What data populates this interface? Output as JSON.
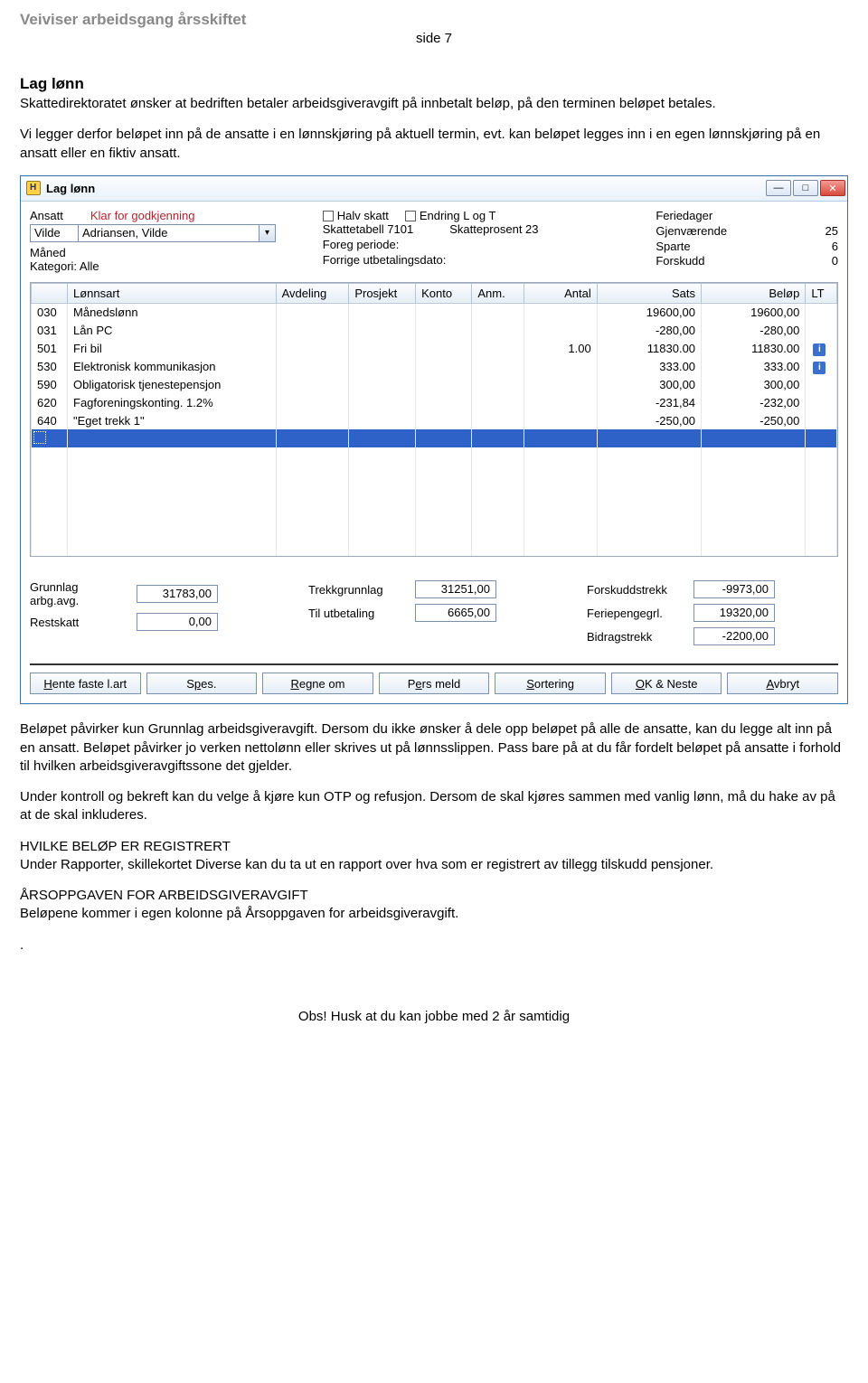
{
  "doc": {
    "header": "Veiviser arbeidsgang årsskiftet",
    "page": "side 7",
    "section_title": "Lag lønn",
    "para1": "Skattedirektoratet ønsker at bedriften betaler arbeidsgiveravgift på innbetalt beløp, på den terminen beløpet betales.",
    "para2": "Vi legger derfor beløpet inn på de ansatte i en lønnskjøring på aktuell termin, evt. kan beløpet legges inn i en egen lønnskjøring på en ansatt eller en fiktiv ansatt.",
    "para3": "Beløpet påvirker kun Grunnlag arbeidsgiveravgift. Dersom du ikke ønsker å dele opp beløpet på alle de ansatte, kan du legge alt inn på en ansatt. Beløpet påvirker jo verken nettolønn eller skrives ut på lønnsslippen. Pass bare på at du får fordelt beløpet på ansatte i forhold til hvilken arbeidsgiveravgiftssone det gjelder.",
    "para4": "Under kontroll og bekreft kan du velge å kjøre kun OTP og refusjon. Dersom de skal kjøres sammen med vanlig lønn, må du hake av på at de skal inkluderes.",
    "para5_title": "HVILKE BELØP ER REGISTRERT",
    "para5": "Under Rapporter, skillekortet Diverse kan du ta ut en rapport over hva som er registrert av tillegg tilskudd pensjoner.",
    "para6_title": "ÅRSOPPGAVEN FOR ARBEIDSGIVERAVGIFT",
    "para6": "Beløpene kommer i egen kolonne på Årsoppgaven for arbeidsgiveravgift.",
    "footer": "Obs! Husk at du kan jobbe med 2 år samtidig"
  },
  "app": {
    "title": "Lag lønn",
    "info": {
      "ansatt_label": "Ansatt",
      "status_label": "Klar for godkjenning",
      "ansatt_name_first": "Vilde",
      "ansatt_name_full": "Adriansen, Vilde",
      "maned_label": "Måned",
      "kategori_label": "Kategori: Alle",
      "halv_skatt": "Halv skatt",
      "endring": "Endring L og T",
      "skattetabell": "Skattetabell 7101",
      "skatteprosent": "Skatteprosent 23",
      "foreg": "Foreg periode:",
      "forrige_utb": "Forrige utbetalingsdato:",
      "feriedager_label": "Feriedager",
      "gjen_label": "Gjenværende",
      "gjen_val": "25",
      "sparte_label": "Sparte",
      "sparte_val": "6",
      "forskudd_label": "Forskudd",
      "forskudd_val": "0"
    },
    "table": {
      "headers": [
        "",
        "Lønnsart",
        "Avdeling",
        "Prosjekt",
        "Konto",
        "Anm.",
        "Antal",
        "Sats",
        "Beløp",
        "LT"
      ],
      "rows": [
        {
          "code": "030",
          "name": "Månedslønn",
          "antal": "",
          "sats": "19600,00",
          "belop": "19600,00",
          "lt": ""
        },
        {
          "code": "031",
          "name": "Lån PC",
          "antal": "",
          "sats": "-280,00",
          "belop": "-280,00",
          "lt": ""
        },
        {
          "code": "501",
          "name": "Fri bil",
          "antal": "1.00",
          "sats": "11830.00",
          "belop": "11830.00",
          "lt": "i"
        },
        {
          "code": "530",
          "name": "Elektronisk kommunikasjon",
          "antal": "",
          "sats": "333.00",
          "belop": "333.00",
          "lt": "i"
        },
        {
          "code": "590",
          "name": "Obligatorisk tjenestepensjon",
          "antal": "",
          "sats": "300,00",
          "belop": "300,00",
          "lt": ""
        },
        {
          "code": "620",
          "name": "Fagforeningskonting. 1.2%",
          "antal": "",
          "sats": "-231,84",
          "belop": "-232,00",
          "lt": ""
        },
        {
          "code": "640",
          "name": "\"Eget trekk 1\"",
          "antal": "",
          "sats": "-250,00",
          "belop": "-250,00",
          "lt": ""
        }
      ]
    },
    "summary": {
      "grunnlag_label": "Grunnlag arbg.avg.",
      "grunnlag_val": "31783,00",
      "restskatt_label": "Restskatt",
      "restskatt_val": "0,00",
      "trekkgr_label": "Trekkgrunnlag",
      "trekkgr_val": "31251,00",
      "tilutb_label": "Til utbetaling",
      "tilutb_val": "6665,00",
      "forskuddstrekk_label": "Forskuddstrekk",
      "forskuddstrekk_val": "-9973,00",
      "feriep_label": "Feriepengegrl.",
      "feriep_val": "19320,00",
      "bidrag_label": "Bidragstrekk",
      "bidrag_val": "-2200,00"
    },
    "buttons": {
      "hente": "Hente faste l.art",
      "spes": "Spes.",
      "regne": "Regne om",
      "pers": "Pers meld",
      "sort": "Sortering",
      "ok": "OK & Neste",
      "avbryt": "Avbryt"
    }
  }
}
